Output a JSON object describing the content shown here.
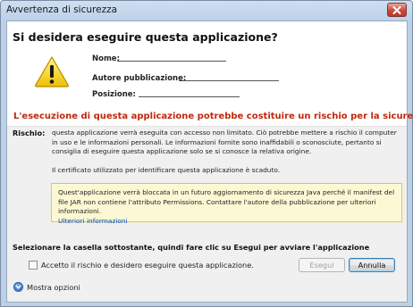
{
  "window": {
    "title": "Avvertenza di sicurezza"
  },
  "dialog": {
    "question": "Si desidera eseguire questa applicazione?",
    "fields": {
      "name_label": "Nome:",
      "publisher_label": "Autore pubblicazione:",
      "location_label": "Posizione:"
    },
    "risk_headline": "L'esecuzione di questa applicazione potrebbe costituire un rischio per la sicurezza",
    "risk_label": "Rischio:",
    "risk_paragraph": "questa applicazione verrà eseguita con accesso non limitato. Ciò potrebbe mettere a rischio il computer in uso e le informazioni personali. Le informazioni fornite sono inaffidabili o sconosciute, pertanto si consiglia di eseguire questa applicazione solo se si conosce la relativa origine.",
    "certificate_paragraph": "Il certificato utilizzato per identificare questa applicazione è scaduto.",
    "notice_text": "Quest'applicazione verrà bloccata in un futuro aggiornamento di sicurezza Java perché il manifest del file JAR non contiene l'attributo Permissions. Contattare l'autore della pubblicazione per ulteriori informazioni.",
    "notice_link": "Ulteriori informazioni",
    "instruction": "Selezionare la casella sottostante, quindi fare clic su Esegui per avviare l'applicazione",
    "accept_checkbox_label": "Accetto il rischio e desidero eseguire questa applicazione.",
    "run_button": "Esegui",
    "cancel_button": "Annulla",
    "more_options": "Mostra opzioni"
  },
  "icons": {
    "warning": "warning-triangle-icon",
    "close": "close-icon",
    "expand": "chevron-down-icon"
  },
  "colors": {
    "risk_text": "#c0280c",
    "notice_bg": "#fdf8d4",
    "notice_border": "#e8c92e",
    "link": "#0b4bb4"
  },
  "state": {
    "accept_checked": false,
    "run_enabled": false
  }
}
